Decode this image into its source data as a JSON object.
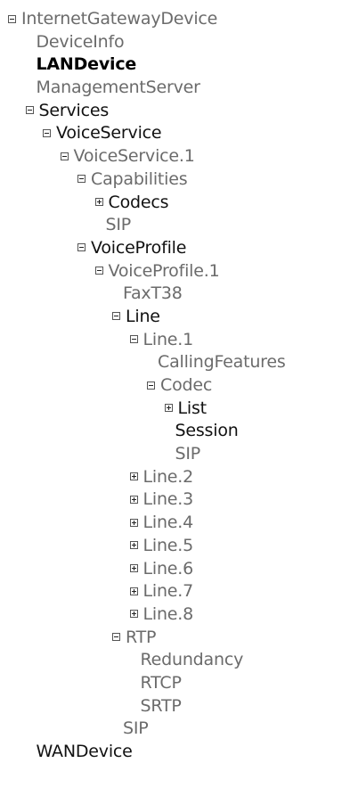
{
  "tree": [
    {
      "label": "InternetGatewayDevice",
      "depth": 0,
      "toggle": "expanded",
      "style": "gray"
    },
    {
      "label": "DeviceInfo",
      "depth": 1,
      "toggle": "none",
      "style": "gray"
    },
    {
      "label": "LANDevice",
      "depth": 1,
      "toggle": "none",
      "style": "bold"
    },
    {
      "label": "ManagementServer",
      "depth": 1,
      "toggle": "none",
      "style": "gray"
    },
    {
      "label": "Services",
      "depth": 1,
      "toggle": "expanded",
      "style": "dark"
    },
    {
      "label": "VoiceService",
      "depth": 2,
      "toggle": "expanded",
      "style": "dark"
    },
    {
      "label": "VoiceService.1",
      "depth": 3,
      "toggle": "expanded",
      "style": "gray"
    },
    {
      "label": "Capabilities",
      "depth": 4,
      "toggle": "expanded",
      "style": "gray"
    },
    {
      "label": "Codecs",
      "depth": 5,
      "toggle": "collapsed",
      "style": "dark"
    },
    {
      "label": "SIP",
      "depth": 5,
      "toggle": "none",
      "style": "gray"
    },
    {
      "label": "VoiceProfile",
      "depth": 4,
      "toggle": "expanded",
      "style": "dark"
    },
    {
      "label": "VoiceProfile.1",
      "depth": 5,
      "toggle": "expanded",
      "style": "gray"
    },
    {
      "label": "FaxT38",
      "depth": 6,
      "toggle": "none",
      "style": "gray"
    },
    {
      "label": "Line",
      "depth": 6,
      "toggle": "expanded",
      "style": "dark"
    },
    {
      "label": "Line.1",
      "depth": 7,
      "toggle": "expanded",
      "style": "gray"
    },
    {
      "label": "CallingFeatures",
      "depth": 8,
      "toggle": "none",
      "style": "gray"
    },
    {
      "label": "Codec",
      "depth": 8,
      "toggle": "expanded",
      "style": "gray"
    },
    {
      "label": "List",
      "depth": 9,
      "toggle": "collapsed",
      "style": "dark"
    },
    {
      "label": "Session",
      "depth": 9,
      "toggle": "none",
      "style": "dark"
    },
    {
      "label": "SIP",
      "depth": 9,
      "toggle": "none",
      "style": "gray"
    },
    {
      "label": "Line.2",
      "depth": 7,
      "toggle": "collapsed",
      "style": "gray"
    },
    {
      "label": "Line.3",
      "depth": 7,
      "toggle": "collapsed",
      "style": "gray"
    },
    {
      "label": "Line.4",
      "depth": 7,
      "toggle": "collapsed",
      "style": "gray"
    },
    {
      "label": "Line.5",
      "depth": 7,
      "toggle": "collapsed",
      "style": "gray"
    },
    {
      "label": "Line.6",
      "depth": 7,
      "toggle": "collapsed",
      "style": "gray"
    },
    {
      "label": "Line.7",
      "depth": 7,
      "toggle": "collapsed",
      "style": "gray"
    },
    {
      "label": "Line.8",
      "depth": 7,
      "toggle": "collapsed",
      "style": "gray"
    },
    {
      "label": "RTP",
      "depth": 6,
      "toggle": "expanded",
      "style": "gray"
    },
    {
      "label": "Redundancy",
      "depth": 7,
      "toggle": "none",
      "style": "gray"
    },
    {
      "label": "RTCP",
      "depth": 7,
      "toggle": "none",
      "style": "gray"
    },
    {
      "label": "SRTP",
      "depth": 7,
      "toggle": "none",
      "style": "gray"
    },
    {
      "label": "SIP",
      "depth": 6,
      "toggle": "none",
      "style": "gray"
    },
    {
      "label": "WANDevice",
      "depth": 1,
      "toggle": "none",
      "style": "dark"
    }
  ]
}
